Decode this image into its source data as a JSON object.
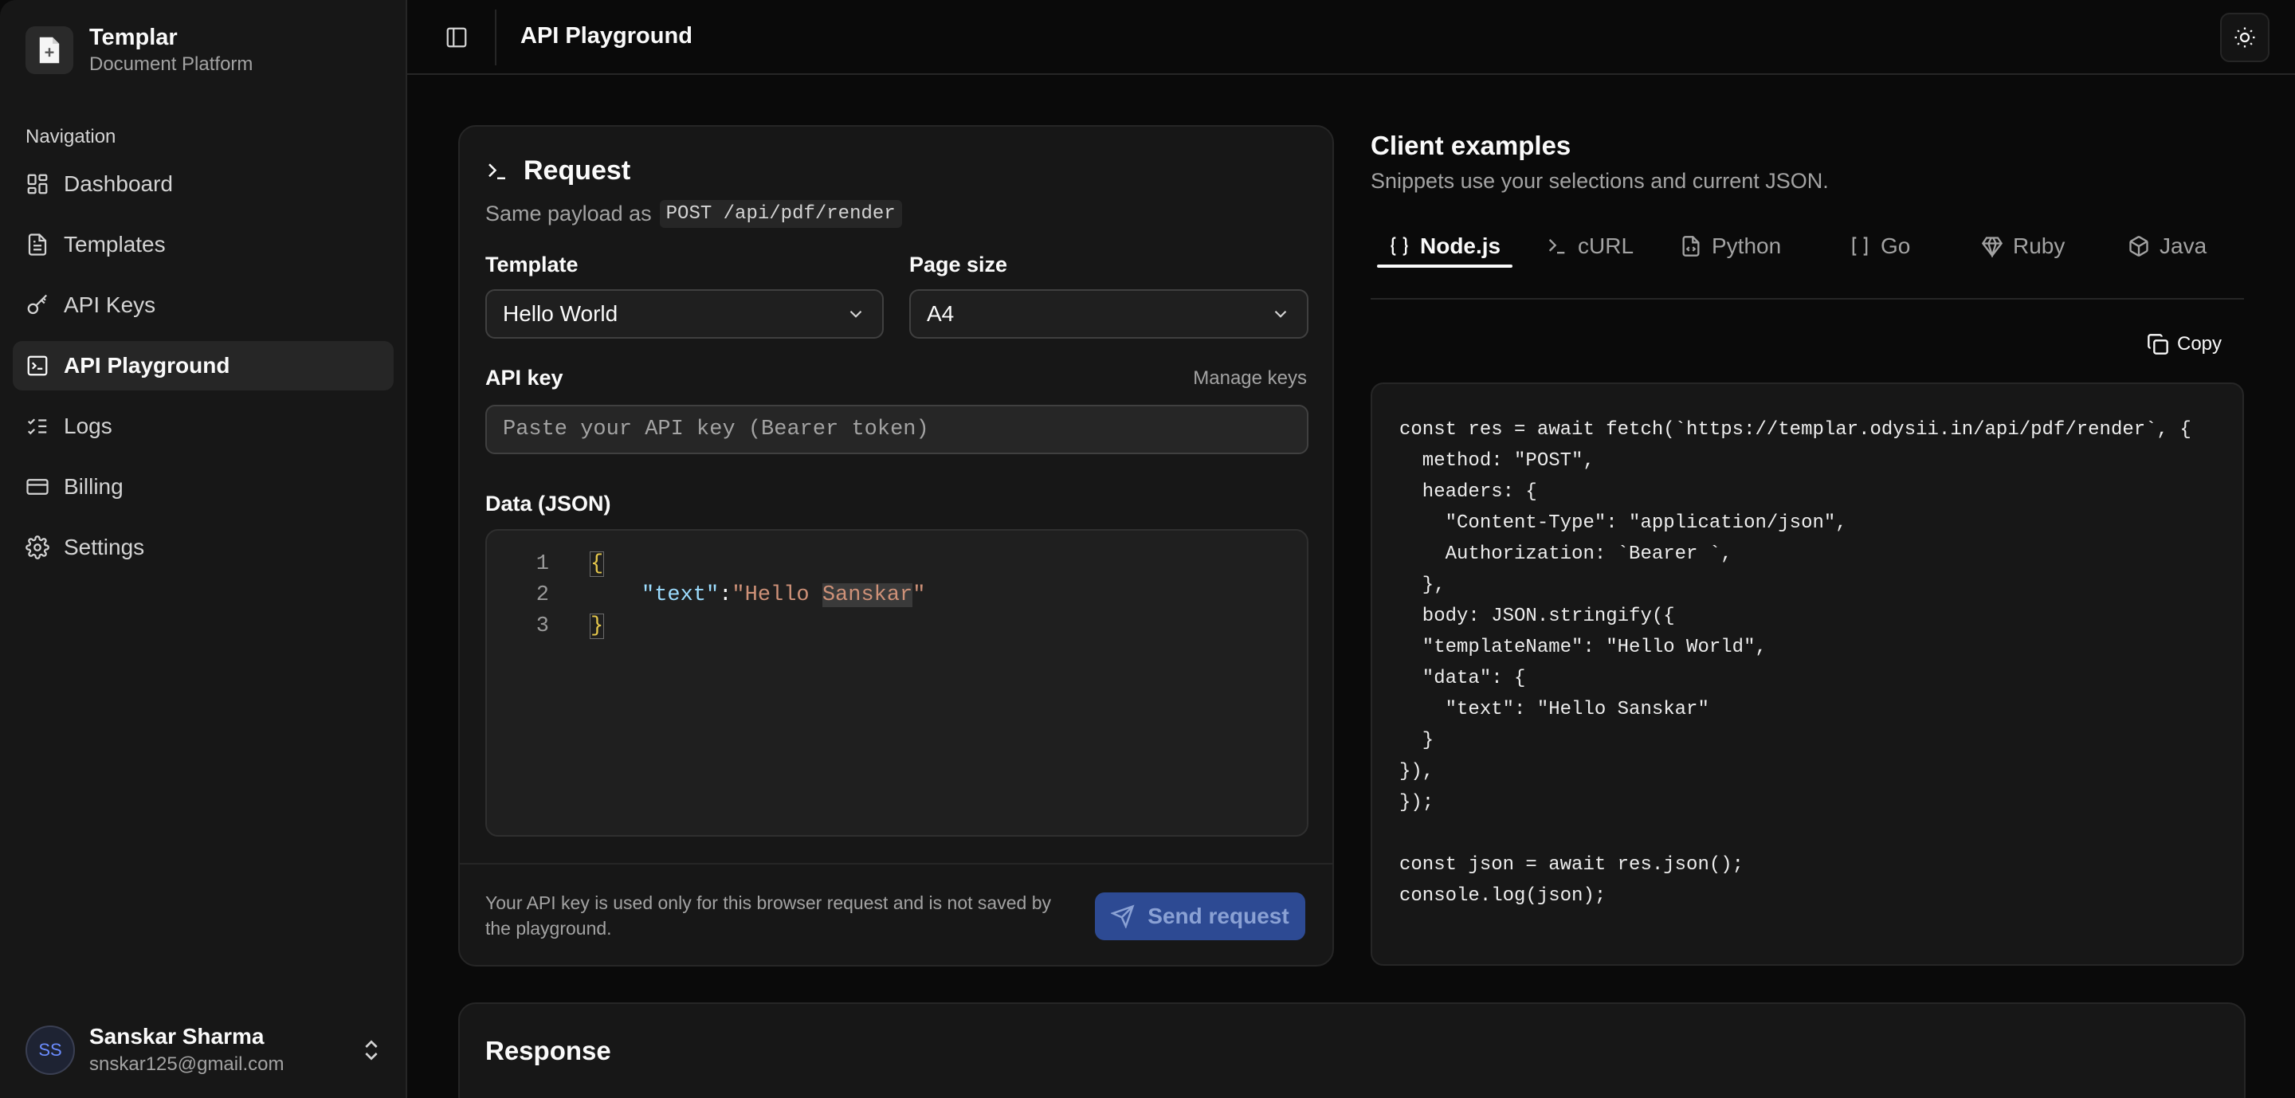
{
  "brand": {
    "title": "Templar",
    "subtitle": "Document Platform"
  },
  "sidebar": {
    "section_label": "Navigation",
    "items": [
      {
        "label": "Dashboard",
        "icon": "dashboard-icon",
        "active": false
      },
      {
        "label": "Templates",
        "icon": "file-text-icon",
        "active": false
      },
      {
        "label": "API Keys",
        "icon": "key-icon",
        "active": false
      },
      {
        "label": "API Playground",
        "icon": "terminal-square-icon",
        "active": true
      },
      {
        "label": "Logs",
        "icon": "list-checks-icon",
        "active": false
      },
      {
        "label": "Billing",
        "icon": "credit-card-icon",
        "active": false
      },
      {
        "label": "Settings",
        "icon": "gear-icon",
        "active": false
      }
    ]
  },
  "user": {
    "initials": "SS",
    "name": "Sanskar Sharma",
    "email": "snskar125@gmail.com"
  },
  "header": {
    "title": "API Playground"
  },
  "request": {
    "title": "Request",
    "subtitle": "Same payload as",
    "endpoint": "POST /api/pdf/render",
    "template_label": "Template",
    "template_value": "Hello World",
    "page_size_label": "Page size",
    "page_size_value": "A4",
    "api_key_label": "API key",
    "manage_keys": "Manage keys",
    "api_key_placeholder": "Paste your API key (Bearer token)",
    "data_label": "Data (JSON)",
    "editor": {
      "line_numbers": [
        "1",
        "2",
        "3"
      ],
      "open_brace": "{",
      "close_brace": "}",
      "key": "\"text\"",
      "colon": ":",
      "value_prefix": "\"Hello ",
      "value_highlight": "Sanskar",
      "value_suffix": "\""
    },
    "footer_note": "Your API key is used only for this browser request and is not saved by the playground.",
    "send_label": "Send request"
  },
  "client_examples": {
    "title": "Client examples",
    "subtitle": "Snippets use your selections and current JSON.",
    "tabs": [
      {
        "label": "Node.js",
        "icon": "braces-icon",
        "active": true
      },
      {
        "label": "cURL",
        "icon": "terminal-icon",
        "active": false
      },
      {
        "label": "Python",
        "icon": "file-code-icon",
        "active": false
      },
      {
        "label": "Go",
        "icon": "brackets-icon",
        "active": false
      },
      {
        "label": "Ruby",
        "icon": "gem-icon",
        "active": false
      },
      {
        "label": "Java",
        "icon": "package-icon",
        "active": false
      }
    ],
    "copy_label": "Copy",
    "code_lines": [
      "const res = await fetch(`https://templar.odysii.in/api/pdf/render`, {",
      "  method: \"POST\",",
      "  headers: {",
      "    \"Content-Type\": \"application/json\",",
      "    Authorization: `Bearer `,",
      "  },",
      "  body: JSON.stringify({",
      "  \"templateName\": \"Hello World\",",
      "  \"data\": {",
      "    \"text\": \"Hello Sanskar\"",
      "  }",
      "}),",
      "});",
      "",
      "const json = await res.json();",
      "console.log(json);"
    ]
  },
  "response": {
    "title": "Response"
  }
}
